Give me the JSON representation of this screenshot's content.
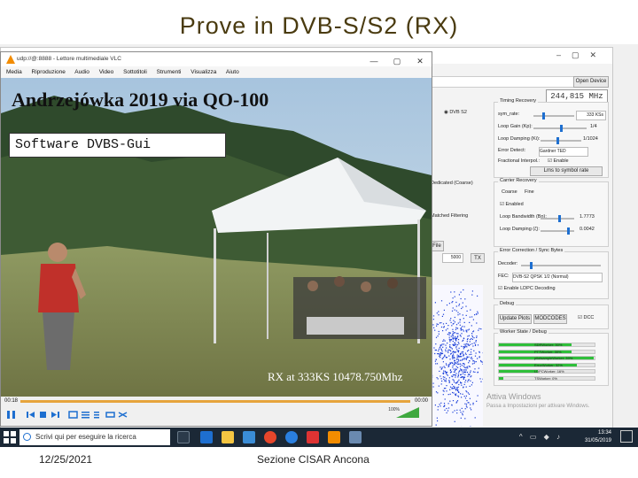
{
  "slide": {
    "title": "Prove in DVB-S/S2 (RX)",
    "overlay_title": "Andrzejówka 2019 via QO-100",
    "software_label": "Software DVBS-Gui",
    "rx_label": "RX at 333KS 10478.750Mhz",
    "footer_date": "12/25/2021",
    "footer_center": "Sezione CISAR Ancona"
  },
  "vlc": {
    "title": "udp://@:8888 - Lettore multimediale VLC",
    "menu": [
      "Media",
      "Riproduzione",
      "Audio",
      "Video",
      "Sottotitoli",
      "Strumenti",
      "Visualizza",
      "Aiuto"
    ],
    "time_elapsed": "00:18",
    "time_total": "00:00",
    "volume": "100%",
    "window_controls": [
      "—",
      "▢",
      "✕"
    ]
  },
  "background_app": {
    "open_device_label": "Open Device",
    "frequency": "244,815 MHz",
    "timing_recovery": {
      "title": "Timing Recovery",
      "rows": [
        {
          "label": "sym_rate:",
          "value": "333 KSs"
        },
        {
          "label": "Loop Gain (Kp):",
          "value": "1/4"
        },
        {
          "label": "Loop Damping (Ki):",
          "value": "1/1024"
        },
        {
          "label": "Error Detect:",
          "value": "Gardner TED"
        },
        {
          "label": "Fractional Interpol.:",
          "value": "Enable"
        }
      ],
      "button": "Lms to symbol rate"
    },
    "carrier_recovery": {
      "title": "Carrier Recovery",
      "tabs": [
        "Coarse",
        "Fine"
      ],
      "enabled_label": "Enabled",
      "rows": [
        {
          "label": "Loop Bandwidth (Bn):",
          "value": "1.7773"
        },
        {
          "label": "Loop Damping (ζ):",
          "value": "0.0042"
        }
      ]
    },
    "error_correction": {
      "title": "Error Correction / Sync Bytes",
      "decoder_label": "Decoder:",
      "fec_label": "FEC:",
      "fec_value": "DVB-S2 QPSK 1/2 (Normal)",
      "ldpc_label": "Enable LDPC Decoding"
    },
    "debug": {
      "title": "Debug",
      "update_plots": "Update Plots",
      "modcodes": "MODCODES",
      "dcc": "DCC"
    },
    "worker_state": {
      "title": "Worker State / Debug",
      "bars": [
        {
          "label": "SDRWorker: 30%",
          "fraction": 0.3
        },
        {
          "label": "PTTWorker: 30%",
          "fraction": 0.3
        },
        {
          "label": "pilotsampleWorker: 39%",
          "fraction": 0.39
        },
        {
          "label": "ErrorWorker: 32%",
          "fraction": 0.32
        },
        {
          "label": "LDPCWorker: 16%",
          "fraction": 0.16
        },
        {
          "label": "TSWorker: 0%",
          "fraction": 0.0
        }
      ]
    },
    "left_labels": [
      "DVB S2",
      "File",
      "Dedicated (Coarse)",
      "Matched Filtering"
    ],
    "spinner_value": "5000",
    "tx_label": "TX",
    "watermark_title": "Attiva Windows",
    "watermark_sub": "Passa a Impostazioni per attivare Windows."
  },
  "taskbar": {
    "search_placeholder": "Scrivi qui per eseguire la ricerca",
    "clock_time": "13:34",
    "clock_date": "31/05/2019"
  },
  "colors": {
    "title": "#4a3b10",
    "vlc_orange": "#f28c00",
    "taskbar": "#1b2836",
    "progress_green": "#2fbf3a"
  }
}
